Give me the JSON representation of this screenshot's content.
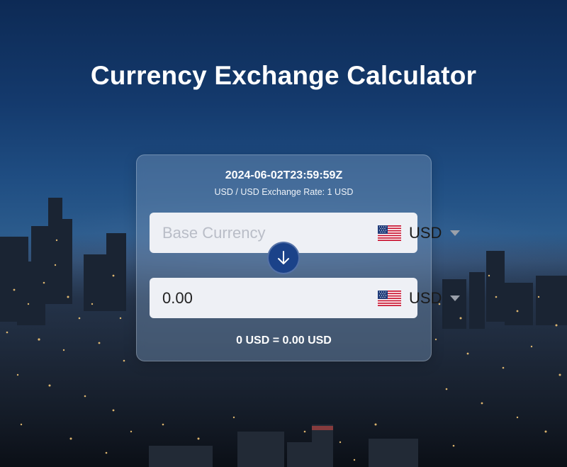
{
  "page": {
    "title": "Currency Exchange Calculator"
  },
  "converter": {
    "timestamp": "2024-06-02T23:59:59Z",
    "rate_text": "USD / USD Exchange Rate: 1 USD",
    "base": {
      "amount_value": "",
      "amount_placeholder": "Base Currency",
      "currency_code": "USD",
      "flag": "us-flag-icon"
    },
    "quote": {
      "amount_value": "0.00",
      "currency_code": "USD",
      "flag": "us-flag-icon"
    },
    "swap_icon": "arrow-down-icon",
    "result_text": "0 USD = 0.00 USD"
  },
  "colors": {
    "swap_button": "#1b4289",
    "input_background": "#eef0f5"
  }
}
